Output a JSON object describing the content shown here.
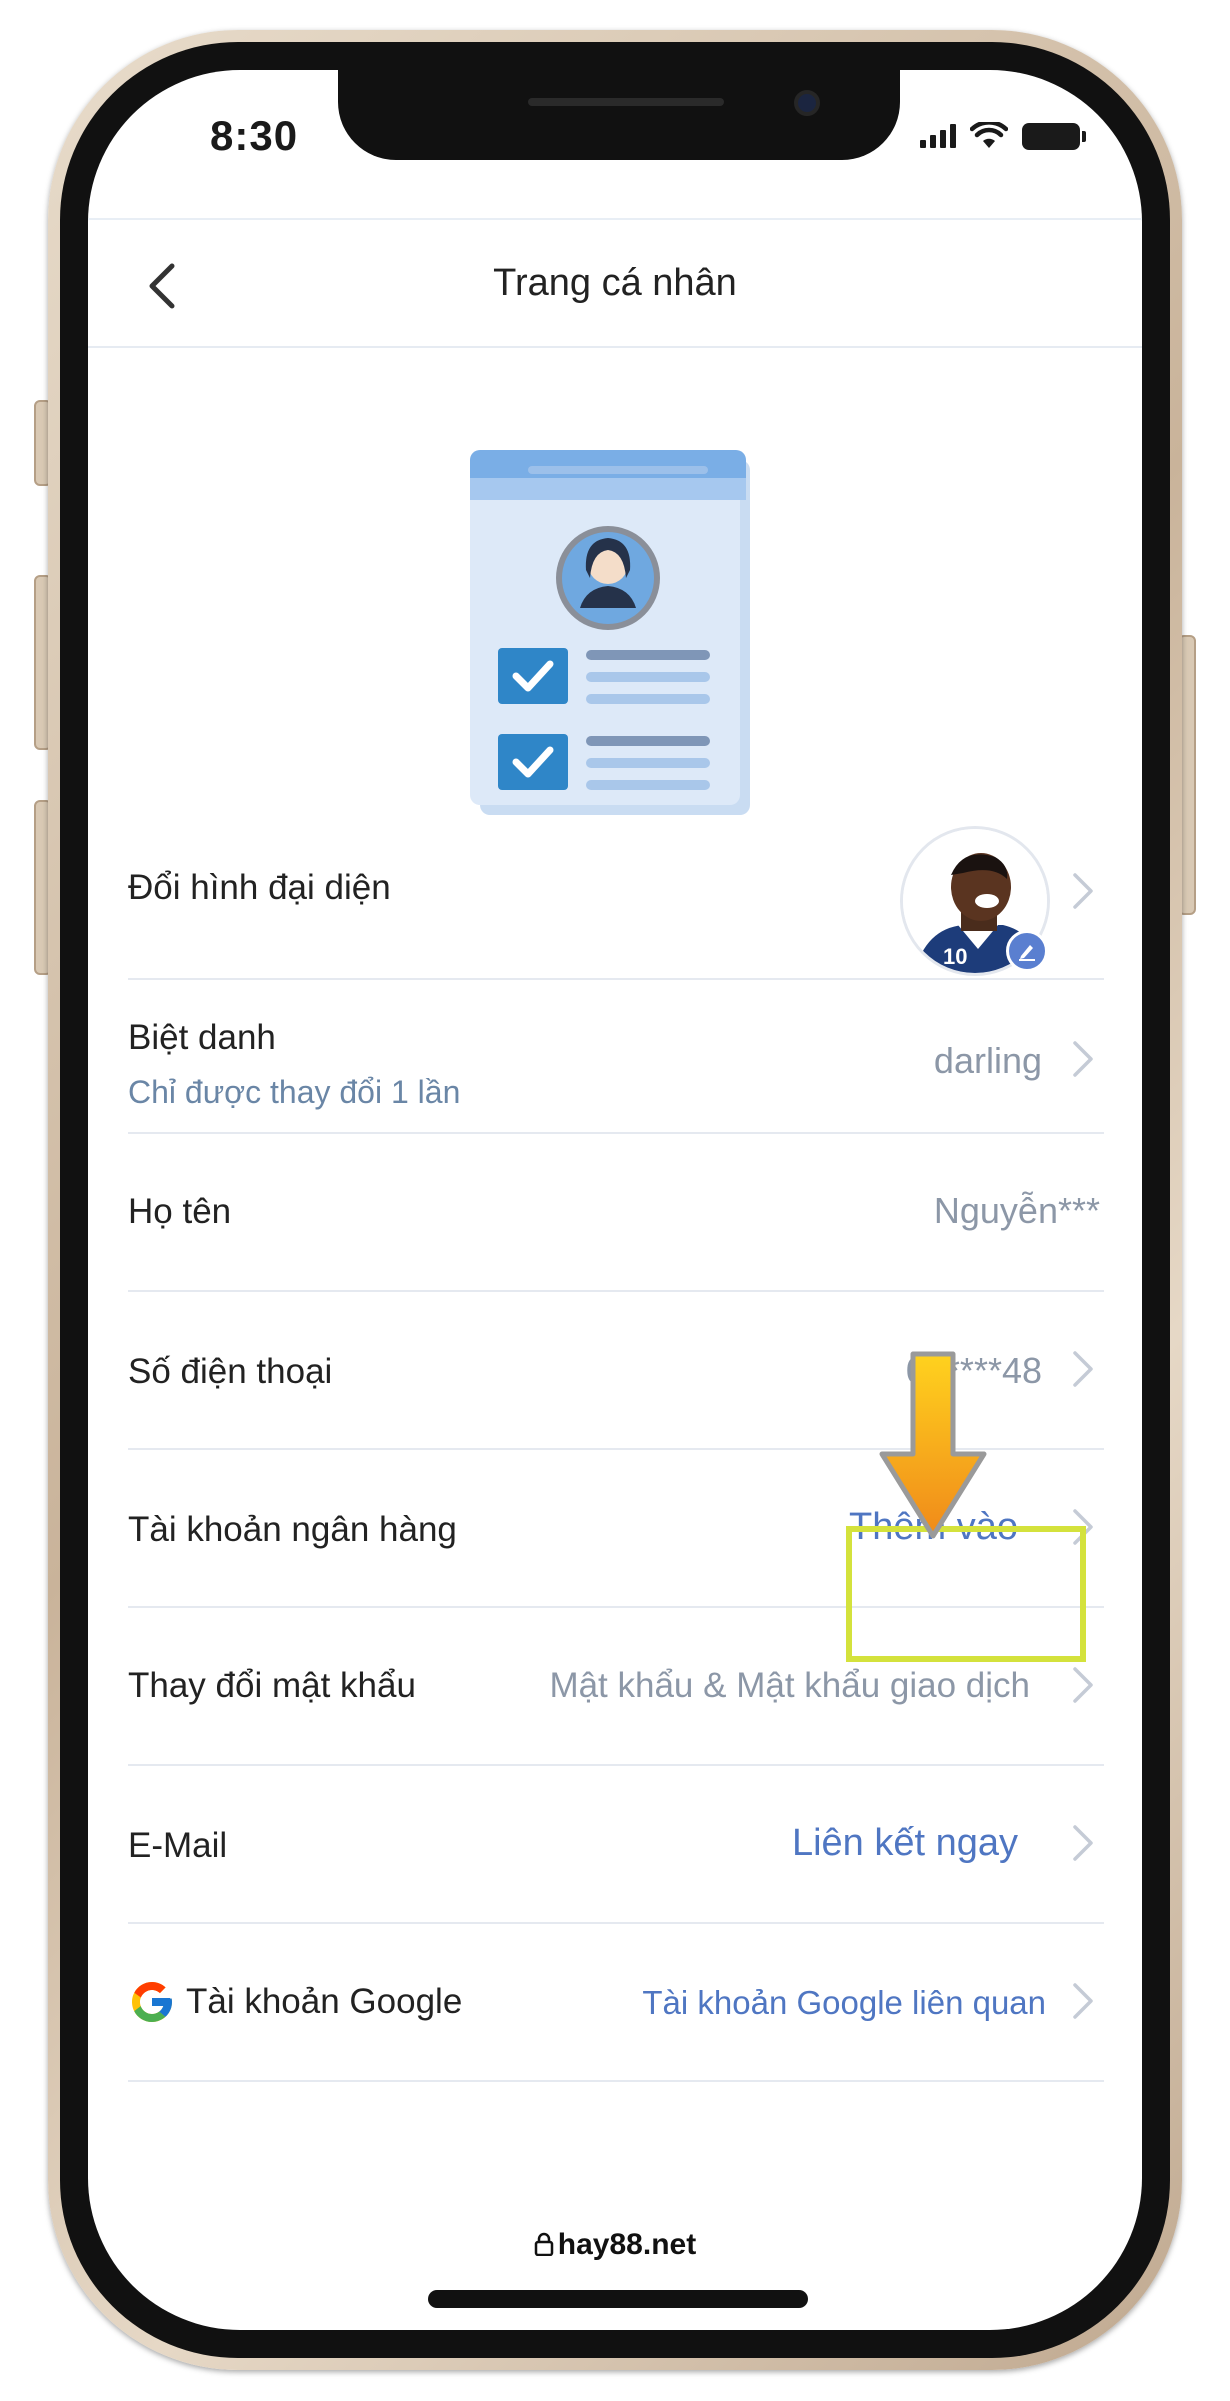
{
  "status_bar": {
    "time": "8:30"
  },
  "header": {
    "title": "Trang cá nhân"
  },
  "rows": {
    "avatar": {
      "label": "Đổi hình đại diện"
    },
    "nickname": {
      "label": "Biệt danh",
      "sub": "Chỉ được thay đổi 1 lần",
      "value": "darling"
    },
    "fullname": {
      "label": "Họ tên",
      "value": "Nguyễn***"
    },
    "phone": {
      "label": "Số điện thoại",
      "value": "06****48"
    },
    "bank": {
      "label": "Tài khoản ngân hàng",
      "value": "Thêm vào"
    },
    "password": {
      "label": "Thay đổi mật khẩu",
      "value": "Mật khẩu & Mật khẩu giao dịch"
    },
    "email": {
      "label": "E-Mail",
      "value": "Liên kết ngay"
    },
    "google": {
      "label": "Tài khoản Google",
      "value": "Tài khoản Google liên quan"
    }
  },
  "footer": {
    "domain": "hay88.net"
  },
  "colors": {
    "accent_blue": "#4f76c2",
    "muted_value": "#8c97a7",
    "sub_text": "#6a86a6",
    "highlight": "#d4e23c",
    "arrow": "#f7a21b"
  }
}
